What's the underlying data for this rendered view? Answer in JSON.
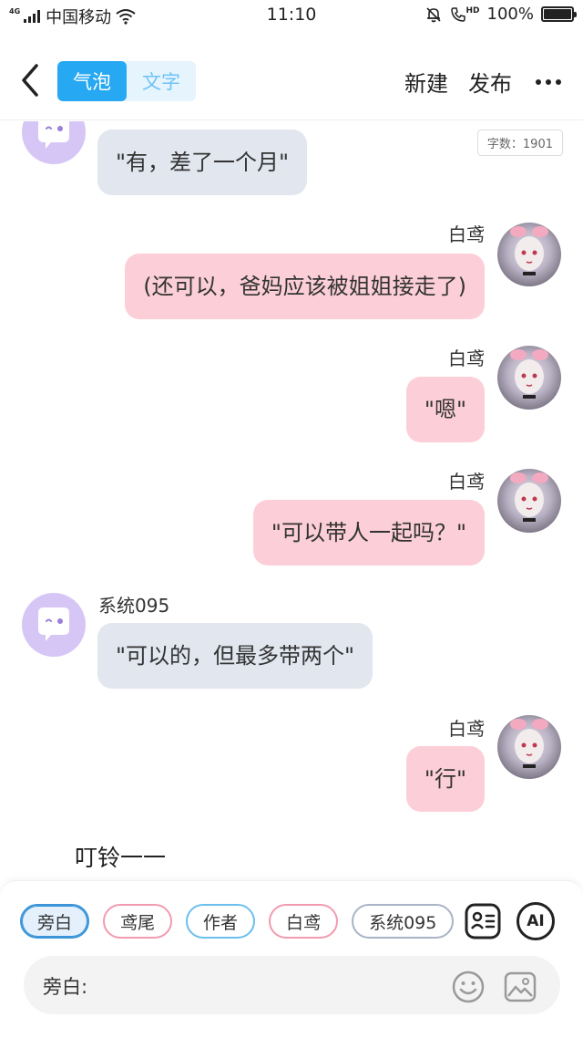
{
  "status_bar": {
    "network": "4G",
    "carrier": "中国移动",
    "time": "11:10",
    "hd_label": "HD",
    "battery": "100%",
    "battery_level": 1.0
  },
  "nav": {
    "tabs": [
      {
        "label": "气泡",
        "active": true
      },
      {
        "label": "文字",
        "active": false
      }
    ],
    "new_label": "新建",
    "publish_label": "发布"
  },
  "chat": {
    "word_count": "字数：1901",
    "messages": [
      {
        "speaker": "",
        "side": "left",
        "text": "\"有，差了一个月\""
      },
      {
        "speaker": "白鸢",
        "side": "right",
        "text": "(还可以，爸妈应该被姐姐接走了)"
      },
      {
        "speaker": "白鸢",
        "side": "right",
        "text": "\"嗯\""
      },
      {
        "speaker": "白鸢",
        "side": "right",
        "text": "\"可以带人一起吗？\""
      },
      {
        "speaker": "系统095",
        "side": "left",
        "text": "\"可以的，但最多带两个\""
      },
      {
        "speaker": "白鸢",
        "side": "right",
        "text": "\"行\""
      }
    ],
    "narration": "叮铃一一"
  },
  "bottom": {
    "roles": [
      {
        "label": "旁白",
        "active": true
      },
      {
        "label": "鸢尾",
        "active": false
      },
      {
        "label": "作者",
        "active": false
      },
      {
        "label": "白鸢",
        "active": false
      },
      {
        "label": "系统095",
        "active": false
      }
    ],
    "ai_label": "AI",
    "input_label": "旁白:"
  },
  "colors": {
    "accent": "#27a8f2",
    "bubble_me": "#fccfd8",
    "bubble_other": "#e1e6ef",
    "system_avatar": "#d6c6f5"
  },
  "icons": [
    "back-chevron-icon",
    "more-icon",
    "ghost-icon",
    "character-card-icon",
    "emoji-icon",
    "image-icon"
  ]
}
